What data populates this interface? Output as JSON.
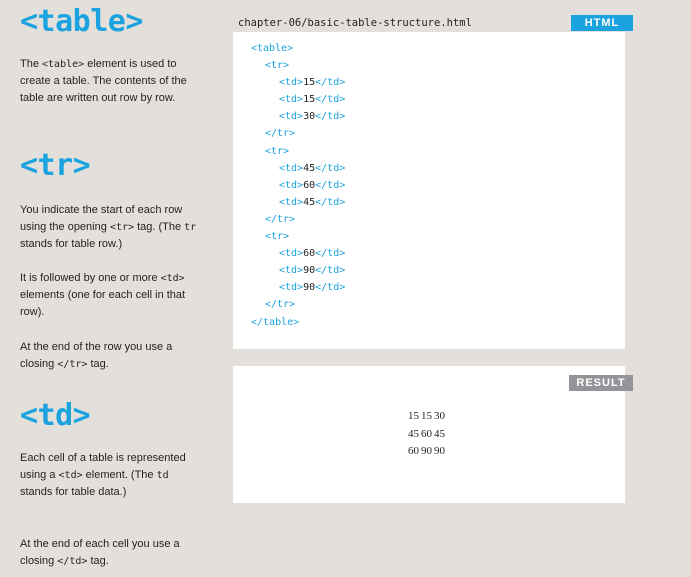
{
  "sections": [
    {
      "heading": "<table>",
      "paragraphs": [
        [
          {
            "t": "The "
          },
          {
            "c": "<table>"
          },
          {
            "t": " element is used to create a table. The contents of the table are written out row by row."
          }
        ]
      ]
    },
    {
      "heading": "<tr>",
      "paragraphs": [
        [
          {
            "t": "You indicate the start of each row using the opening "
          },
          {
            "c": "<tr>"
          },
          {
            "t": " tag. (The "
          },
          {
            "c": "tr"
          },
          {
            "t": " stands for table row.)"
          }
        ],
        [
          {
            "t": "It is followed by one or more "
          },
          {
            "c": "<td>"
          },
          {
            "t": " elements (one for each cell in that row)."
          }
        ],
        [
          {
            "t": "At the end of the row you use a closing "
          },
          {
            "c": "</tr>"
          },
          {
            "t": " tag."
          }
        ]
      ]
    },
    {
      "heading": "<td>",
      "paragraphs": [
        [
          {
            "t": "Each cell of a table is represented using a "
          },
          {
            "c": "<td>"
          },
          {
            "t": " element. (The "
          },
          {
            "c": "td"
          },
          {
            "t": " stands for table data.)"
          }
        ],
        [
          {
            "t": "At the end of each cell you use a closing "
          },
          {
            "c": "</td>"
          },
          {
            "t": " tag."
          }
        ]
      ]
    }
  ],
  "code_panel": {
    "filename": "chapter-06/basic-table-structure.html",
    "label": "HTML",
    "lines": [
      {
        "indent": 0,
        "tag": "<table>"
      },
      {
        "indent": 1,
        "tag": "<tr>"
      },
      {
        "indent": 2,
        "open": "<td>",
        "text": "15",
        "close": "</td>"
      },
      {
        "indent": 2,
        "open": "<td>",
        "text": "15",
        "close": "</td>"
      },
      {
        "indent": 2,
        "open": "<td>",
        "text": "30",
        "close": "</td>"
      },
      {
        "indent": 1,
        "tag": "</tr>"
      },
      {
        "indent": 1,
        "tag": "<tr>"
      },
      {
        "indent": 2,
        "open": "<td>",
        "text": "45",
        "close": "</td>"
      },
      {
        "indent": 2,
        "open": "<td>",
        "text": "60",
        "close": "</td>"
      },
      {
        "indent": 2,
        "open": "<td>",
        "text": "45",
        "close": "</td>"
      },
      {
        "indent": 1,
        "tag": "</tr>"
      },
      {
        "indent": 1,
        "tag": "<tr>"
      },
      {
        "indent": 2,
        "open": "<td>",
        "text": "60",
        "close": "</td>"
      },
      {
        "indent": 2,
        "open": "<td>",
        "text": "90",
        "close": "</td>"
      },
      {
        "indent": 2,
        "open": "<td>",
        "text": "90",
        "close": "</td>"
      },
      {
        "indent": 1,
        "tag": "</tr>"
      },
      {
        "indent": 0,
        "tag": "</table>"
      }
    ]
  },
  "result_panel": {
    "label": "RESULT",
    "rows": [
      [
        "15",
        "15",
        "30"
      ],
      [
        "45",
        "60",
        "45"
      ],
      [
        "60",
        "90",
        "90"
      ]
    ]
  },
  "colors": {
    "accent": "#1aa3de",
    "result_label": "#939598",
    "background": "#e3e0dc"
  }
}
